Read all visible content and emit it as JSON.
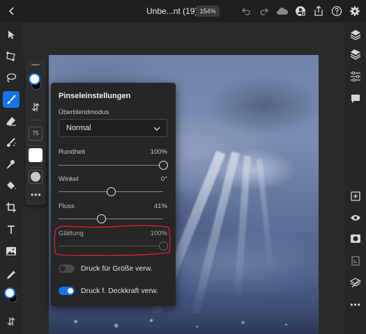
{
  "topbar": {
    "doc_title": "Unbe...nt (19)",
    "zoom": "154%",
    "icons": [
      "back-icon",
      "undo-icon",
      "redo-icon",
      "cloud-icon",
      "add-user-icon",
      "share-icon",
      "help-icon",
      "settings-icon"
    ]
  },
  "left_tools": [
    "move-icon",
    "transform-icon",
    "lasso-icon",
    "brush-icon",
    "eraser-icon",
    "healing-icon",
    "clone-stamp-icon",
    "fill-icon",
    "crop-icon",
    "type-icon",
    "image-icon",
    "eyedropper-icon",
    "color-swatch-icon",
    "swap-icon"
  ],
  "brushbar": {
    "size": "75"
  },
  "right_tools": [
    "layers-icon",
    "layer-stack-icon",
    "adjustments-icon",
    "comment-icon",
    "add-layer-icon",
    "visibility-icon",
    "mask-icon",
    "clip-icon",
    "layer-properties-icon",
    "more-icon"
  ],
  "popover": {
    "title": "Pinseleinstellungen",
    "blend_mode_label": "Überblendmodus",
    "blend_mode_value": "Normal",
    "sliders": [
      {
        "label": "Rundheit",
        "value": "100%",
        "fraction": 1.0
      },
      {
        "label": "Winkel",
        "value": "0°",
        "fraction": 0.5
      },
      {
        "label": "Fluss",
        "value": "41%",
        "fraction": 0.41
      },
      {
        "label": "Glättung",
        "value": "100%",
        "fraction": 1.0
      }
    ],
    "toggles": [
      {
        "label": "Druck für Größe verw.",
        "on": false
      },
      {
        "label": "Druck f. Deckkraft verw.",
        "on": true
      }
    ]
  },
  "colors": {
    "accent": "#1473e6",
    "annotation": "#d62030"
  }
}
